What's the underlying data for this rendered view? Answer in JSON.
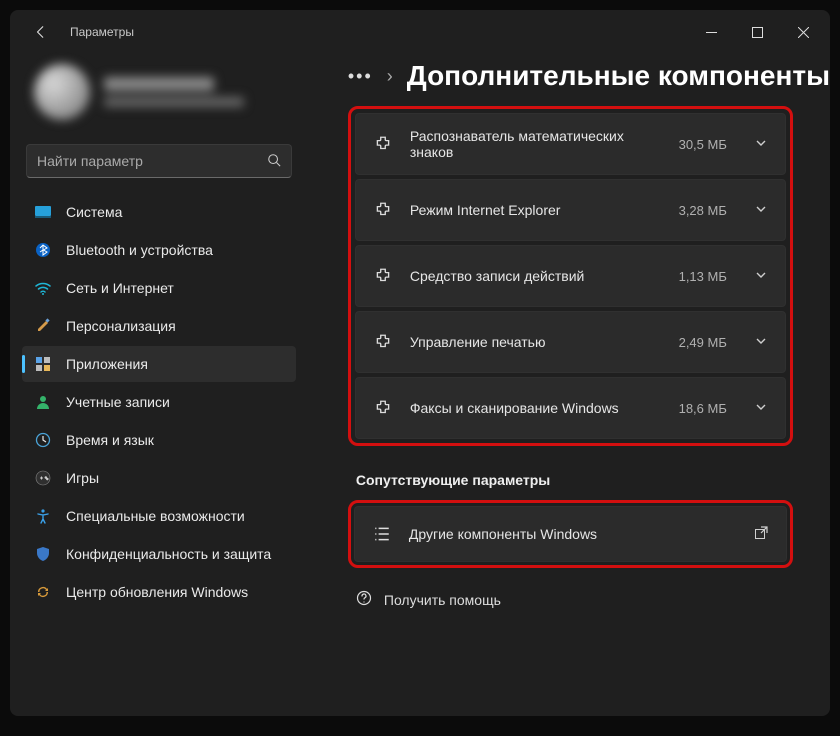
{
  "window": {
    "title": "Параметры"
  },
  "search": {
    "placeholder": "Найти параметр"
  },
  "nav": [
    {
      "key": "system",
      "label": "Система"
    },
    {
      "key": "bluetooth",
      "label": "Bluetooth и устройства"
    },
    {
      "key": "network",
      "label": "Сеть и Интернет"
    },
    {
      "key": "personalization",
      "label": "Персонализация"
    },
    {
      "key": "apps",
      "label": "Приложения"
    },
    {
      "key": "accounts",
      "label": "Учетные записи"
    },
    {
      "key": "time",
      "label": "Время и язык"
    },
    {
      "key": "gaming",
      "label": "Игры"
    },
    {
      "key": "accessibility",
      "label": "Специальные возможности"
    },
    {
      "key": "privacy",
      "label": "Конфиденциальность и защита"
    },
    {
      "key": "update",
      "label": "Центр обновления Windows"
    }
  ],
  "header": {
    "page_title": "Дополнительные компоненты"
  },
  "features": [
    {
      "label": "Распознаватель математических знаков",
      "size": "30,5 МБ"
    },
    {
      "label": "Режим Internet Explorer",
      "size": "3,28 МБ"
    },
    {
      "label": "Средство записи действий",
      "size": "1,13 МБ"
    },
    {
      "label": "Управление печатью",
      "size": "2,49 МБ"
    },
    {
      "label": "Факсы и сканирование Windows",
      "size": "18,6 МБ"
    }
  ],
  "related": {
    "section_title": "Сопутствующие параметры",
    "row_label": "Другие компоненты Windows"
  },
  "help": {
    "label": "Получить помощь"
  }
}
